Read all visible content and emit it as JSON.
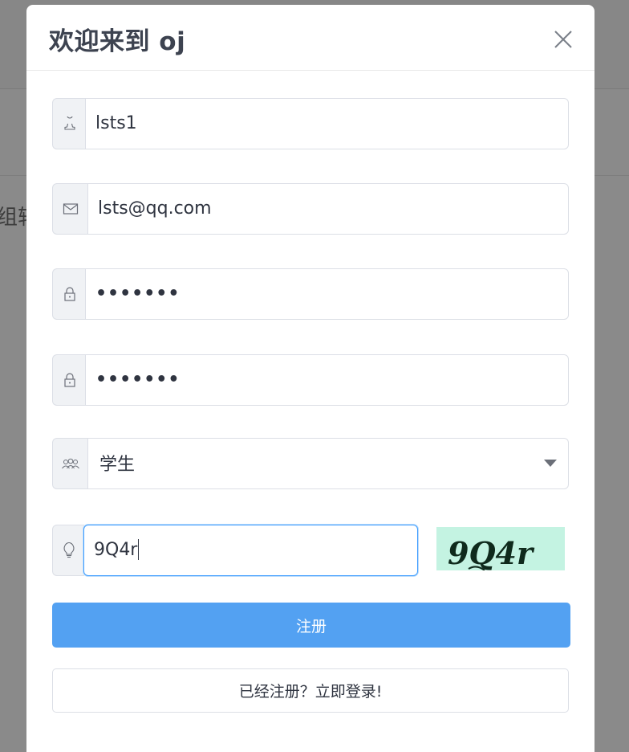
{
  "background": {
    "partial_text": "组轴"
  },
  "dialog": {
    "title": "欢迎来到 oj",
    "close_icon": "close-icon"
  },
  "form": {
    "username": {
      "icon": "user-icon",
      "value": "lsts1"
    },
    "email": {
      "icon": "mail-icon",
      "value": "lsts@qq.com"
    },
    "password": {
      "icon": "lock-icon",
      "masked_value": "•••••••"
    },
    "confirm_password": {
      "icon": "lock-icon",
      "masked_value": "•••••••"
    },
    "role": {
      "icon": "users-icon",
      "selected": "学生",
      "dropdown_icon": "caret-down-icon"
    },
    "captcha": {
      "icon": "lightbulb-icon",
      "value": "9Q4r",
      "image_text": "9Q4r"
    }
  },
  "buttons": {
    "register": "注册",
    "go_login": "已经注册？立即登录!"
  },
  "colors": {
    "primary": "#53a1f2",
    "focus_border": "#409eff",
    "captcha_bg": "#c4f3e2",
    "overlay": "#8a8a8a"
  }
}
